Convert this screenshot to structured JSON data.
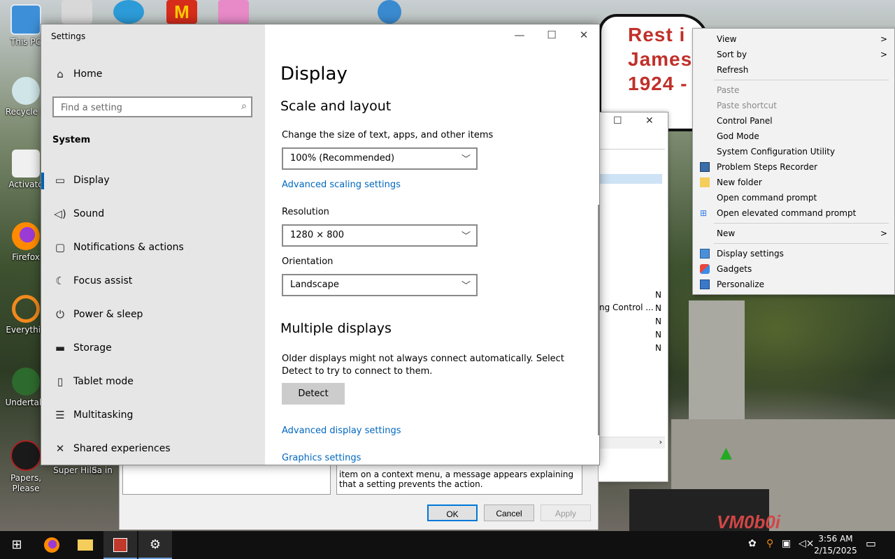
{
  "desktop": {
    "icons": [
      {
        "label": "This PC"
      },
      {
        "label": "Recycle B"
      },
      {
        "label": "Activato"
      },
      {
        "label": "Firefox"
      },
      {
        "label": "Everythin"
      },
      {
        "label": "Undertale"
      },
      {
        "label": "Papers, Please"
      },
      {
        "label": "Super Hilda"
      },
      {
        "label": "Sa in"
      }
    ],
    "wallpaper_sign": [
      "Rest i",
      "James",
      "1924 -"
    ],
    "wallpaper_brand": "VM0b0i"
  },
  "settings": {
    "app_title": "Settings",
    "nav_home": "Home",
    "search_placeholder": "Find a setting",
    "section": "System",
    "nav": [
      {
        "label": "Display",
        "icon": "monitor-icon"
      },
      {
        "label": "Sound",
        "icon": "speaker-icon"
      },
      {
        "label": "Notifications & actions",
        "icon": "notification-icon"
      },
      {
        "label": "Focus assist",
        "icon": "moon-icon"
      },
      {
        "label": "Power & sleep",
        "icon": "power-icon"
      },
      {
        "label": "Storage",
        "icon": "storage-icon"
      },
      {
        "label": "Tablet mode",
        "icon": "tablet-icon"
      },
      {
        "label": "Multitasking",
        "icon": "multitasking-icon"
      },
      {
        "label": "Shared experiences",
        "icon": "share-icon"
      }
    ],
    "page_title": "Display",
    "scale_heading": "Scale and layout",
    "scale_label": "Change the size of text, apps, and other items",
    "scale_value": "100% (Recommended)",
    "advanced_scaling_link": "Advanced scaling settings",
    "resolution_label": "Resolution",
    "resolution_value": "1280 × 800",
    "orientation_label": "Orientation",
    "orientation_value": "Landscape",
    "multi_heading": "Multiple displays",
    "multi_text": "Older displays might not always connect automatically. Select Detect to try to connect to them.",
    "detect_button": "Detect",
    "advanced_display_link": "Advanced display settings",
    "graphics_link": "Graphics settings"
  },
  "background_window": {
    "row_text": "ng Control ...",
    "n_col": [
      "N",
      "N",
      "N",
      "N",
      "N"
    ],
    "help_text": "item on a context menu, a message appears explaining that a setting prevents the action.",
    "ok": "OK",
    "cancel": "Cancel",
    "apply": "Apply"
  },
  "context_menu": {
    "items": [
      {
        "label": "View",
        "submenu": true
      },
      {
        "label": "Sort by",
        "submenu": true
      },
      {
        "label": "Refresh"
      },
      {
        "label": "Paste",
        "disabled": true
      },
      {
        "label": "Paste shortcut",
        "disabled": true
      },
      {
        "label": "Control Panel"
      },
      {
        "label": "God Mode"
      },
      {
        "label": "System Configuration Utility"
      },
      {
        "label": "Problem Steps Recorder"
      },
      {
        "label": "New folder"
      },
      {
        "label": "Open command prompt"
      },
      {
        "label": "Open elevated command prompt"
      },
      {
        "label": "New",
        "submenu": true
      },
      {
        "label": "Display settings"
      },
      {
        "label": "Gadgets"
      },
      {
        "label": "Personalize"
      }
    ]
  },
  "taskbar": {
    "time": "3:56 AM",
    "date": "2/15/2025"
  },
  "colors": {
    "accent": "#0063b1",
    "link": "#0067c0",
    "sidebar_bg": "#e6e6e6",
    "menu_bg": "#f2f2f2"
  }
}
